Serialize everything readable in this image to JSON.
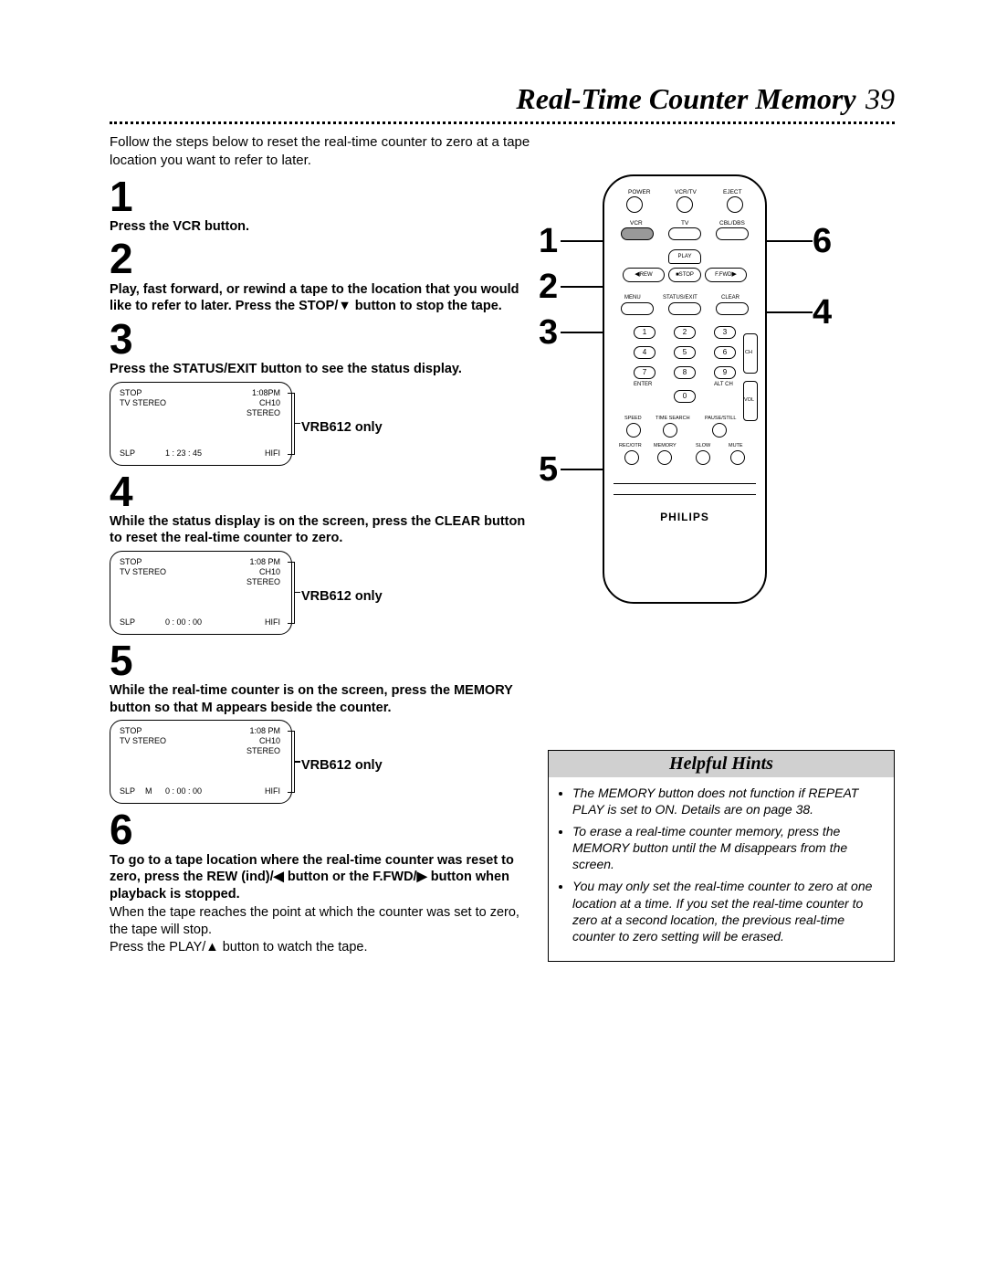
{
  "page": {
    "title": "Real-Time Counter Memory",
    "number": "39"
  },
  "intro": "Follow the steps below to reset the real-time counter to zero at a tape location you want to refer to later.",
  "steps": {
    "n1": "1",
    "t1": "Press the VCR button.",
    "n2": "2",
    "t2": "Play, fast forward, or rewind a tape to the location that you would like to refer to later. Press the STOP/▼ button to stop the tape.",
    "n3": "3",
    "t3": "Press the STATUS/EXIT button to see the status display.",
    "n4": "4",
    "t4": "While the status display is on the screen, press the CLEAR button to reset the real-time counter to zero.",
    "n5": "5",
    "t5": "While the real-time counter is on the screen, press the MEMORY button so that M appears beside the counter.",
    "n6": "6",
    "t6": "To go to a tape location where the real-time counter was reset to zero, press the REW (ind)/◀ button or the F.FWD/▶ button when playback is stopped.",
    "f6a": "When the tape reaches the point at which the counter was set to zero, the tape will stop.",
    "f6b": "Press the PLAY/▲ button to watch the tape."
  },
  "osd_label": "VRB612 only",
  "osd1": {
    "stop": "STOP",
    "time": "1:08PM",
    "tvst": "TV STEREO",
    "ch": "CH10",
    "stereo": "STEREO",
    "slp": "SLP",
    "counter": "1 : 23 : 45",
    "hifi": "HIFI"
  },
  "osd2": {
    "stop": "STOP",
    "time": "1:08 PM",
    "tvst": "TV STEREO",
    "ch": "CH10",
    "stereo": "STEREO",
    "slp": "SLP",
    "counter": "0 : 00 : 00",
    "hifi": "HIFI"
  },
  "osd3": {
    "stop": "STOP",
    "time": "1:08 PM",
    "tvst": "TV STEREO",
    "ch": "CH10",
    "stereo": "STEREO",
    "slp": "SLP",
    "m": "M",
    "counter": "0 : 00 : 00",
    "hifi": "HIFI"
  },
  "remote": {
    "top_labels": [
      "POWER",
      "VCR/TV",
      "EJECT"
    ],
    "mode_labels": [
      "VCR",
      "TV",
      "CBL/DBS"
    ],
    "transport": {
      "play": "PLAY",
      "rew": "REW",
      "stop": "■STOP",
      "ffwd": "F.FWD"
    },
    "row_labels": [
      "MENU",
      "STATUS/EXIT",
      "CLEAR"
    ],
    "keypad": [
      "1",
      "2",
      "3",
      "4",
      "5",
      "6",
      "7",
      "8",
      "9",
      "0"
    ],
    "side_labels": {
      "enter": "ENTER",
      "altch": "ALT CH",
      "ch": "CH",
      "vol": "VOL"
    },
    "bottom_labels": [
      "SPEED",
      "TIME SEARCH",
      "PAUSE/STILL",
      "REC/OTR",
      "MEMORY",
      "SLOW",
      "MUTE"
    ],
    "brand": "PHILIPS"
  },
  "callouts": {
    "c1": "1",
    "c2": "2",
    "c3": "3",
    "c4": "4",
    "c5": "5",
    "c6": "6"
  },
  "hints": {
    "title": "Helpful Hints",
    "items": [
      "The MEMORY button does not function if REPEAT PLAY is set to ON. Details are on page 38.",
      "To erase a real-time counter memory, press the MEMORY button until the M disappears from the screen.",
      "You may only set the real-time counter to zero at one location at a time. If you set the real-time counter to zero at a second location, the previous real-time counter to zero setting will be erased."
    ]
  }
}
